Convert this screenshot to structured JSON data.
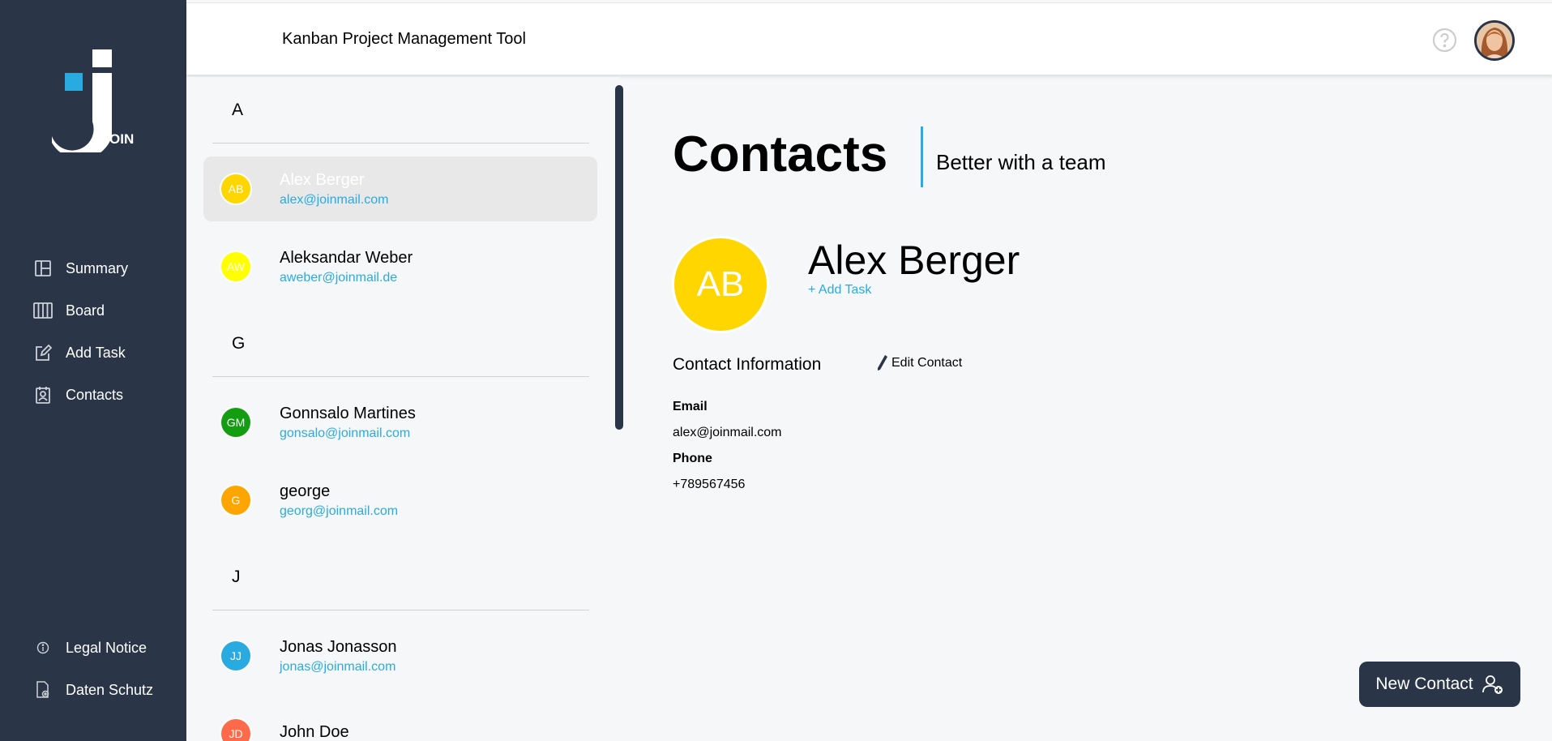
{
  "header": {
    "title": "Kanban Project Management Tool",
    "help_icon": "question-circle-icon"
  },
  "logo": {
    "text": "OIN"
  },
  "sidebar": {
    "items": [
      {
        "label": "Summary",
        "icon": "summary-icon"
      },
      {
        "label": "Board",
        "icon": "board-icon"
      },
      {
        "label": "Add Task",
        "icon": "add-task-icon"
      },
      {
        "label": "Contacts",
        "icon": "contacts-icon"
      }
    ],
    "bottom": [
      {
        "label": "Legal Notice",
        "icon": "info-icon"
      },
      {
        "label": "Daten Schutz",
        "icon": "privacy-icon"
      }
    ]
  },
  "contacts": {
    "groups": [
      {
        "letter": "A"
      },
      {
        "letter": "G"
      },
      {
        "letter": "J"
      }
    ],
    "items": [
      {
        "initials": "AB",
        "name": "Alex Berger",
        "email": "alex@joinmail.com",
        "color": "#ffd600"
      },
      {
        "initials": "AW",
        "name": "Aleksandar Weber",
        "email": "aweber@joinmail.de",
        "color": "#ffff00"
      },
      {
        "initials": "GM",
        "name": "Gonnsalo Martines",
        "email": "gonsalo@joinmail.com",
        "color": "#129e10"
      },
      {
        "initials": "G",
        "name": "george",
        "email": "georg@joinmail.com",
        "color": "#ffa500"
      },
      {
        "initials": "JJ",
        "name": "Jonas Jonasson",
        "email": "jonas@joinmail.com",
        "color": "#29abe2"
      },
      {
        "initials": "JD",
        "name": "John Doe",
        "email": "",
        "color": "#ff6a4a"
      }
    ]
  },
  "detail": {
    "title": "Contacts",
    "subtitle": "Better with a team",
    "initials": "AB",
    "name": "Alex Berger",
    "add_task": "+ Add Task",
    "info_title": "Contact Information",
    "edit_label": "Edit Contact",
    "email_label": "Email",
    "email": "alex@joinmail.com",
    "phone_label": "Phone",
    "phone": "+789567456"
  },
  "new_contact": {
    "label": "New Contact"
  }
}
